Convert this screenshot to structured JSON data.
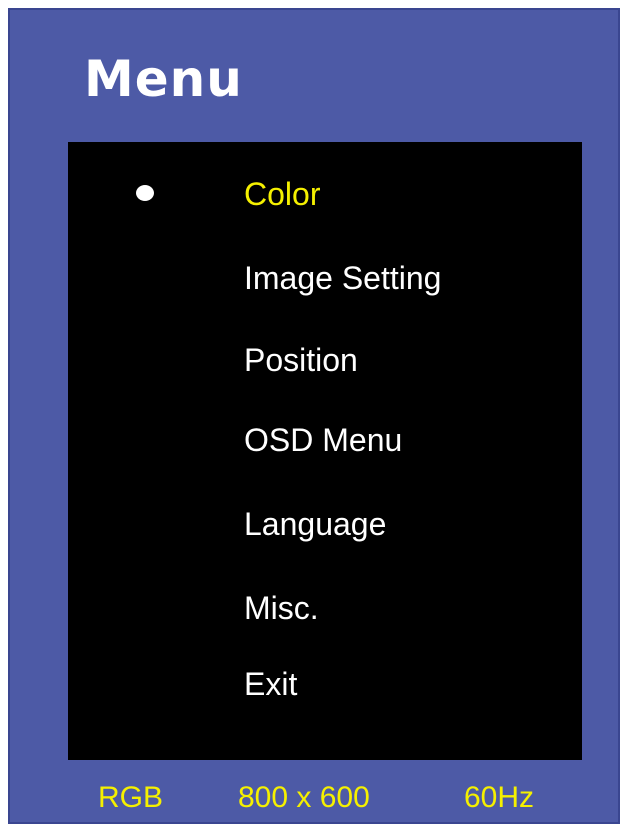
{
  "osd": {
    "title": "Menu",
    "selected_index": 0,
    "items": [
      {
        "label": "Color"
      },
      {
        "label": "Image Setting"
      },
      {
        "label": "Position"
      },
      {
        "label": "OSD Menu"
      },
      {
        "label": "Language"
      },
      {
        "label": "Misc."
      },
      {
        "label": "Exit"
      }
    ],
    "status": {
      "signal": "RGB",
      "resolution": "800 x 600",
      "refresh": "60Hz"
    },
    "colors": {
      "frame": "#4d5aa6",
      "panel": "#000000",
      "text": "#ffffff",
      "highlight": "#f5f000"
    },
    "icons": {
      "selection_marker": "bullet-icon"
    }
  }
}
